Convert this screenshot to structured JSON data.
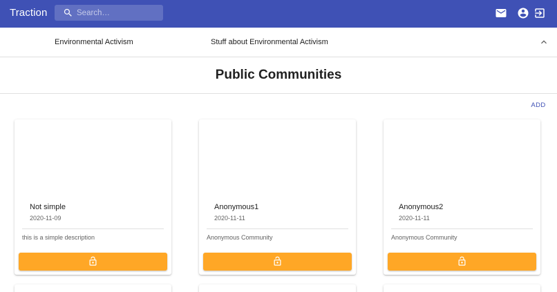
{
  "appbar": {
    "brand": "Traction",
    "search_placeholder": "Search…",
    "icons": [
      "mail-icon",
      "account-circle-icon",
      "logout-icon"
    ],
    "color": "#3f51b5"
  },
  "banner": {
    "name": "Environmental Activism",
    "description": "Stuff about Environmental Activism",
    "toggle_icon": "chevron-up-icon"
  },
  "page": {
    "title": "Public Communities",
    "add_label": "ADD"
  },
  "communities": [
    {
      "name": "Not simple",
      "date": "2020-11-09",
      "description": "this is a simple description",
      "action_icon": "lock-open-icon"
    },
    {
      "name": "Anonymous1",
      "date": "2020-11-11",
      "description": "Anonymous Community",
      "action_icon": "lock-open-icon"
    },
    {
      "name": "Anonymous2",
      "date": "2020-11-11",
      "description": "Anonymous Community",
      "action_icon": "lock-open-icon"
    }
  ],
  "colors": {
    "primary": "#3f51b5",
    "join_button": "#ffa726"
  }
}
